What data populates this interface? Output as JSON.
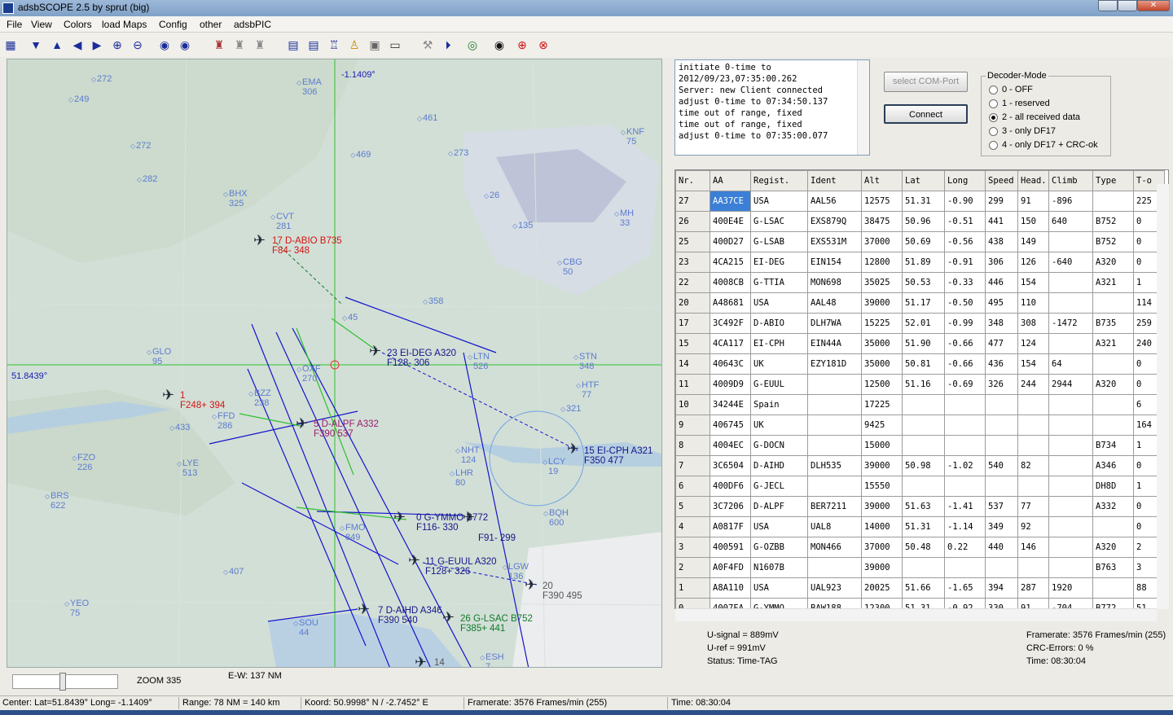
{
  "window": {
    "title": "adsbSCOPE 2.5   by sprut  (big)"
  },
  "menu": [
    "File",
    "View",
    "Colors",
    "load Maps",
    "Config",
    "other",
    "adsbPIC"
  ],
  "log": [
    "initiate 0-time to",
    "2012/09/23,07:35:00.262",
    "Server: new Client connected",
    "adjust 0-time to 07:34:50.137",
    "time out of range, fixed",
    "time out of range, fixed",
    "adjust 0-time to 07:35:00.077"
  ],
  "buttons": {
    "select_com": "select COM-Port",
    "connect": "Connect"
  },
  "decoder": {
    "title": "Decoder-Mode",
    "options": [
      "0 - OFF",
      "1 - reserved",
      "2 - all received data",
      "3 - only DF17",
      "4 - only DF17 + CRC-ok"
    ],
    "selected": 2
  },
  "table": {
    "columns": [
      "Nr.",
      "AA",
      "Regist.",
      "Ident",
      "Alt",
      "Lat",
      "Long",
      "Speed",
      "Head.",
      "Climb",
      "Type",
      "T-o"
    ],
    "rows": [
      [
        "27",
        "AA37CE",
        "USA",
        "AAL56",
        "12575",
        "51.31",
        "-0.90",
        "299",
        "91",
        "-896",
        "",
        "225"
      ],
      [
        "26",
        "400E4E",
        "G-LSAC",
        "EXS879Q",
        "38475",
        "50.96",
        "-0.51",
        "441",
        "150",
        "640",
        "B752",
        "0"
      ],
      [
        "25",
        "400D27",
        "G-LSAB",
        "EXS531M",
        "37000",
        "50.69",
        "-0.56",
        "438",
        "149",
        "",
        "B752",
        "0"
      ],
      [
        "23",
        "4CA215",
        "EI-DEG",
        "EIN154",
        "12800",
        "51.89",
        "-0.91",
        "306",
        "126",
        "-640",
        "A320",
        "0"
      ],
      [
        "22",
        "4008CB",
        "G-TTIA",
        "MON698",
        "35025",
        "50.53",
        "-0.33",
        "446",
        "154",
        "",
        "A321",
        "1"
      ],
      [
        "20",
        "A48681",
        "USA",
        "AAL48",
        "39000",
        "51.17",
        "-0.50",
        "495",
        "110",
        "",
        "",
        "114"
      ],
      [
        "17",
        "3C492F",
        "D-ABIO",
        "DLH7WA",
        "15225",
        "52.01",
        "-0.99",
        "348",
        "308",
        "-1472",
        "B735",
        "259"
      ],
      [
        "15",
        "4CA117",
        "EI-CPH",
        "EIN44A",
        "35000",
        "51.90",
        "-0.66",
        "477",
        "124",
        "",
        "A321",
        "240"
      ],
      [
        "14",
        "40643C",
        "UK",
        "EZY181D",
        "35000",
        "50.81",
        "-0.66",
        "436",
        "154",
        "64",
        "",
        "0"
      ],
      [
        "11",
        "4009D9",
        "G-EUUL",
        "",
        "12500",
        "51.16",
        "-0.69",
        "326",
        "244",
        "2944",
        "A320",
        "0"
      ],
      [
        "10",
        "34244E",
        "Spain",
        "",
        "17225",
        "",
        "",
        "",
        "",
        "",
        "",
        "6"
      ],
      [
        "9",
        "406745",
        "UK",
        "",
        "9425",
        "",
        "",
        "",
        "",
        "",
        "",
        "164"
      ],
      [
        "8",
        "4004EC",
        "G-DOCN",
        "",
        "15000",
        "",
        "",
        "",
        "",
        "",
        "B734",
        "1"
      ],
      [
        "7",
        "3C6504",
        "D-AIHD",
        "DLH535",
        "39000",
        "50.98",
        "-1.02",
        "540",
        "82",
        "",
        "A346",
        "0"
      ],
      [
        "6",
        "400DF6",
        "G-JECL",
        "",
        "15550",
        "",
        "",
        "",
        "",
        "",
        "DH8D",
        "1"
      ],
      [
        "5",
        "3C7206",
        "D-ALPF",
        "BER7211",
        "39000",
        "51.63",
        "-1.41",
        "537",
        "77",
        "",
        "A332",
        "0"
      ],
      [
        "4",
        "A0817F",
        "USA",
        "UAL8",
        "14000",
        "51.31",
        "-1.14",
        "349",
        "92",
        "",
        "",
        "0"
      ],
      [
        "3",
        "400591",
        "G-OZBB",
        "MON466",
        "37000",
        "50.48",
        "0.22",
        "440",
        "146",
        "",
        "A320",
        "2"
      ],
      [
        "2",
        "A0F4FD",
        "N1607B",
        "",
        "39000",
        "",
        "",
        "",
        "",
        "",
        "B763",
        "3"
      ],
      [
        "1",
        "A8A110",
        "USA",
        "UAL923",
        "20025",
        "51.66",
        "-1.65",
        "394",
        "287",
        "1920",
        "",
        "88"
      ],
      [
        "0",
        "4007FA",
        "G-YMMO",
        "BAW188",
        "12300",
        "51.31",
        "-0.92",
        "330",
        "91",
        "-704",
        "B772",
        "51"
      ]
    ]
  },
  "stats": {
    "usignal": "U-signal = 889mV",
    "uref": "U-ref = 991mV",
    "status": "Status: Time-TAG",
    "framerate": "Framerate:  3576 Frames/min (255)",
    "crc": "CRC-Errors: 0 %",
    "time": "Time: 08:30:04"
  },
  "zoom": "ZOOM 335",
  "ew": "E-W: 137 NM",
  "statusbar": {
    "center": "Center: Lat=51.8439° Long= -1.1409°",
    "range": "Range: 78 NM = 140 km",
    "koord": "Koord: 50.9998° N / -2.7452° E",
    "framerate": "Framerate:  3576 Frames/min (255)",
    "time": "Time: 08:30:04"
  },
  "map": {
    "center_lat": "51.8439°",
    "center_lon": "-1.1409°",
    "waypoints": [
      [
        "272"
      ],
      [
        "249"
      ],
      [
        "EMA",
        "306"
      ],
      [
        "461"
      ],
      [
        "KNF",
        "75"
      ],
      [
        "272"
      ],
      [
        "469"
      ],
      [
        "273"
      ],
      [
        "282"
      ],
      [
        "BHX",
        "325"
      ],
      [
        "CVT",
        "281"
      ],
      [
        "26"
      ],
      [
        "MH",
        "33"
      ],
      [
        "135"
      ],
      [
        "CBG",
        "50"
      ],
      [
        "358"
      ],
      [
        "45"
      ],
      [
        "GLO",
        "95"
      ],
      [
        "LTN",
        "526"
      ],
      [
        "STN",
        "348"
      ],
      [
        "OXF",
        "270"
      ],
      [
        "HTF",
        "77"
      ],
      [
        "BZZ",
        "238"
      ],
      [
        "321"
      ],
      [
        "FFD",
        "286"
      ],
      [
        "433"
      ],
      [
        "NHT",
        "124"
      ],
      [
        "FZO",
        "226"
      ],
      [
        "LYE",
        "513"
      ],
      [
        "LHR",
        "80"
      ],
      [
        "LCY",
        "19"
      ],
      [
        "BRS",
        "622"
      ],
      [
        "BQH",
        "600"
      ],
      [
        "407"
      ],
      [
        "LGW",
        "136"
      ],
      [
        "YEO",
        "75"
      ],
      [
        "SOU",
        "44"
      ],
      [
        "ESH",
        "7"
      ],
      [
        "FMO",
        "849"
      ]
    ],
    "aircraft": [
      {
        "l1": "17  D-ABIO  B735",
        "l2": "F84-  348",
        "color": "#d41414"
      },
      {
        "l1": "23  EI-DEG  A320",
        "l2": "F128-  306",
        "color": "#14148a"
      },
      {
        "l1": "1",
        "l2": "F248+  394",
        "color": "#d41414"
      },
      {
        "l1": "5  D-ALPF  A332",
        "l2": "F390   537",
        "color": "#9b1b6e"
      },
      {
        "l1": "15  EI-CPH  A321",
        "l2": "F350   477",
        "color": "#14148a"
      },
      {
        "l1": "0  G-YMMO  B772",
        "l2": "F116-  330",
        "color": "#14148a"
      },
      {
        "l1": "",
        "l2": "F91-  299",
        "color": "#14148a"
      },
      {
        "l1": "11  G-EUUL  A320",
        "l2": "F128+  326",
        "color": "#14148a"
      },
      {
        "l1": "20",
        "l2": "F390   495",
        "color": "#555555"
      },
      {
        "l1": "7  D-AIHD  A346",
        "l2": "F390   540",
        "color": "#14148a"
      },
      {
        "l1": "26  G-LSAC  B752",
        "l2": "F385+  441",
        "color": "#0e7a2a"
      },
      {
        "l1": "14",
        "l2": "",
        "color": "#555555"
      }
    ]
  }
}
